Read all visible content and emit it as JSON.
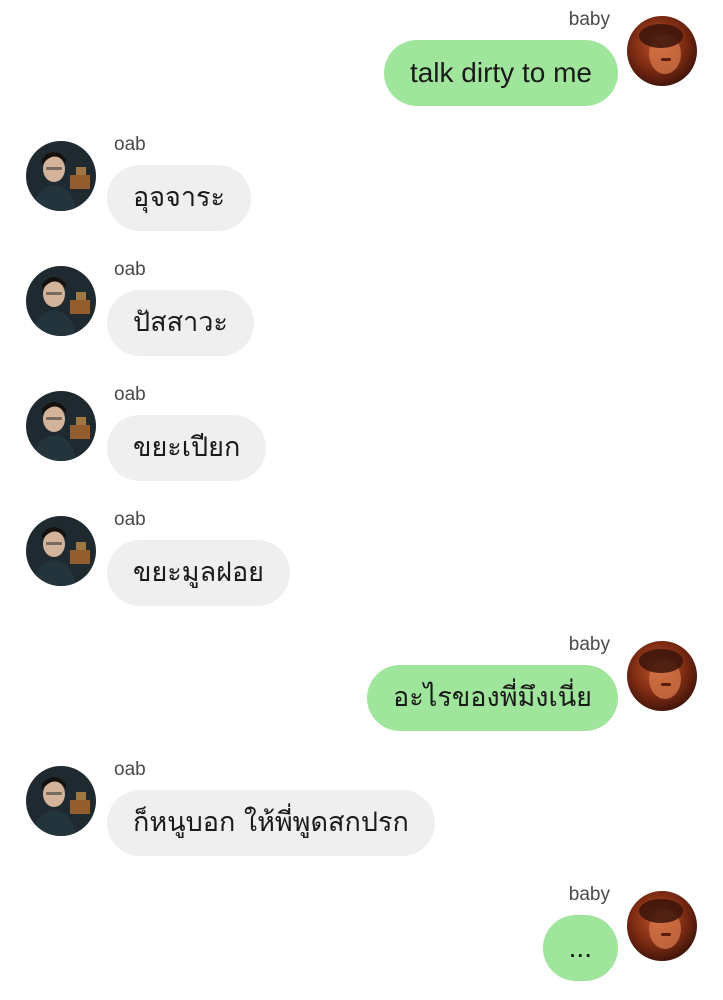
{
  "messages": [
    {
      "sender": "baby",
      "direction": "out",
      "text": "talk dirty to me",
      "avatar": "baby-avatar"
    },
    {
      "sender": "oab",
      "direction": "in",
      "text": "อุจจาระ",
      "avatar": "oab-avatar"
    },
    {
      "sender": "oab",
      "direction": "in",
      "text": "ปัสสาวะ",
      "avatar": "oab-avatar"
    },
    {
      "sender": "oab",
      "direction": "in",
      "text": "ขยะเปียก",
      "avatar": "oab-avatar"
    },
    {
      "sender": "oab",
      "direction": "in",
      "text": "ขยะมูลฝอย",
      "avatar": "oab-avatar"
    },
    {
      "sender": "baby",
      "direction": "out",
      "text": "อะไรของพี่มึงเนี่ย",
      "avatar": "baby-avatar"
    },
    {
      "sender": "oab",
      "direction": "in",
      "text": "ก็หนูบอก ให้พี่พูดสกปรก",
      "avatar": "oab-avatar"
    },
    {
      "sender": "baby",
      "direction": "out",
      "text": "...",
      "avatar": "baby-avatar"
    }
  ],
  "colors": {
    "outgoing_bubble": "#a0e59c",
    "incoming_bubble": "#efefef",
    "sender_name": "#4a4a4a",
    "message_text": "#1a1a1a"
  }
}
